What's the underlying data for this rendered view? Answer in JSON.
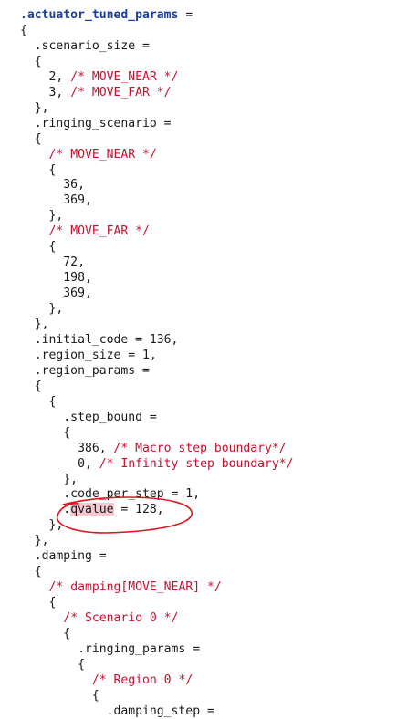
{
  "code": {
    "lines": [
      {
        "text": "",
        "key": ".actuator_tuned_params",
        "rest": " ="
      },
      {
        "text": "{"
      },
      {
        "text": "  .scenario_size ="
      },
      {
        "text": "  {"
      },
      {
        "text": "    2, ",
        "comment": "/* MOVE_NEAR */"
      },
      {
        "text": "    3, ",
        "comment": "/* MOVE_FAR */"
      },
      {
        "text": "  },"
      },
      {
        "text": "  .ringing_scenario ="
      },
      {
        "text": "  {"
      },
      {
        "text": "    ",
        "comment": "/* MOVE_NEAR */"
      },
      {
        "text": "    {"
      },
      {
        "text": "      36,"
      },
      {
        "text": "      369,"
      },
      {
        "text": "    },"
      },
      {
        "text": "    ",
        "comment": "/* MOVE_FAR */"
      },
      {
        "text": "    {"
      },
      {
        "text": "      72,"
      },
      {
        "text": "      198,"
      },
      {
        "text": "      369,"
      },
      {
        "text": "    },"
      },
      {
        "text": "  },"
      },
      {
        "text": "  .initial_code = 136,"
      },
      {
        "text": "  .region_size = 1,"
      },
      {
        "text": "  .region_params ="
      },
      {
        "text": "  {"
      },
      {
        "text": "    {"
      },
      {
        "text": "      .step_bound ="
      },
      {
        "text": "      {"
      },
      {
        "text": "        386, ",
        "comment": "/* Macro step boundary*/"
      },
      {
        "text": "        0, ",
        "comment": "/* Infinity step boundary*/"
      },
      {
        "text": "      },"
      },
      {
        "text": "      .code_per_step = 1,"
      },
      {
        "text": "      .",
        "hl": "qvalue",
        "rest": " = 128,"
      },
      {
        "text": "    },"
      },
      {
        "text": "  },"
      },
      {
        "text": "  .damping ="
      },
      {
        "text": "  {"
      },
      {
        "text": "    ",
        "comment": "/* damping[MOVE_NEAR] */"
      },
      {
        "text": "    {"
      },
      {
        "text": "      ",
        "comment": "/* Scenario 0 */"
      },
      {
        "text": "      {"
      },
      {
        "text": "        .ringing_params ="
      },
      {
        "text": "        {"
      },
      {
        "text": "          ",
        "comment": "/* Region 0 */"
      },
      {
        "text": "          {"
      },
      {
        "text": "            .damping_step ="
      }
    ]
  },
  "colors": {
    "keyword": "#1a3ea0",
    "comment": "#c8102e",
    "highlight": "#f6c7cf",
    "annotation": "#e0151f"
  }
}
